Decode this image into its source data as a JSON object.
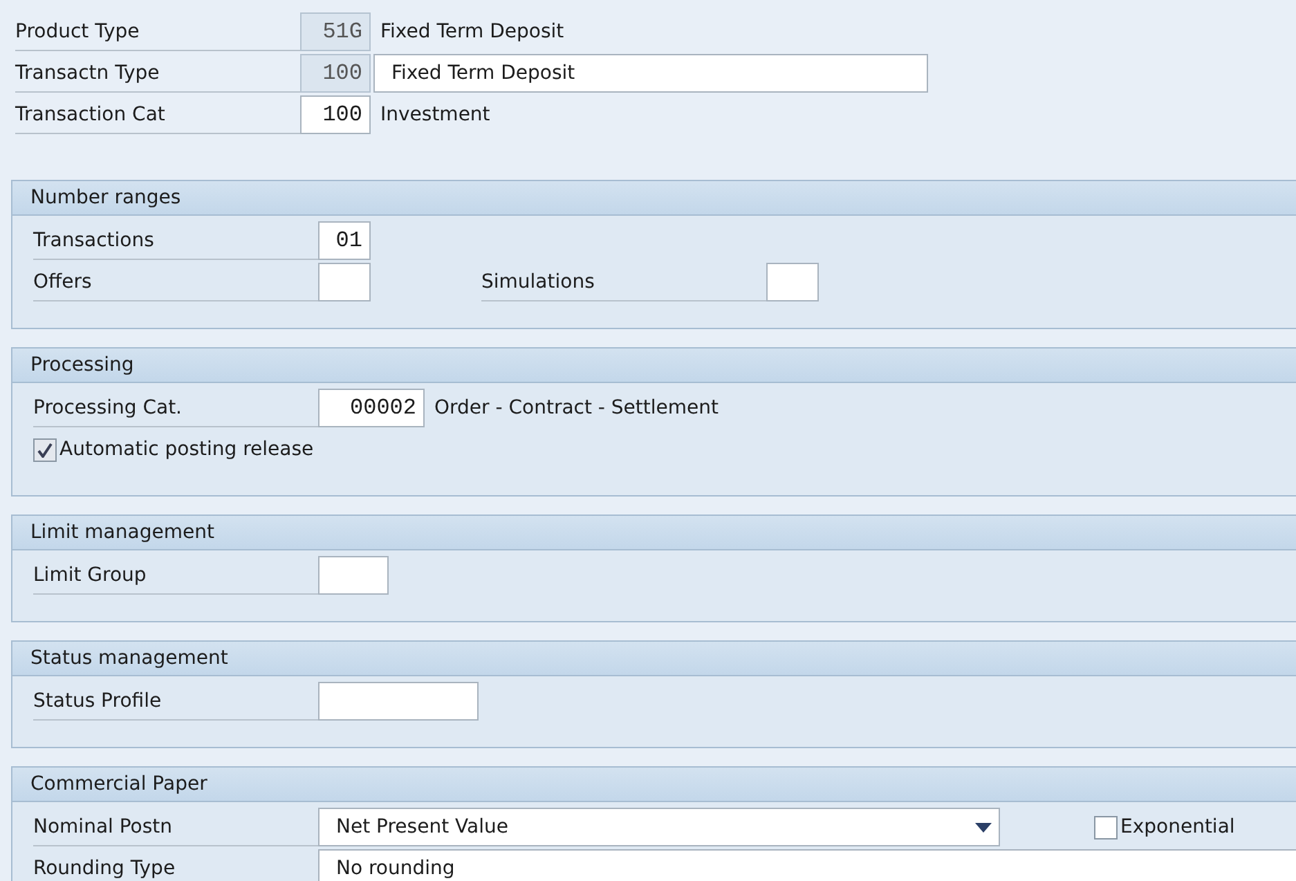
{
  "header": [
    {
      "label": "Product Type",
      "code": "51G",
      "code_readonly": true,
      "text": "Fixed Term Deposit",
      "kind": "plain"
    },
    {
      "label": "Transactn Type",
      "code": "100",
      "code_readonly": true,
      "text": "Fixed Term Deposit",
      "kind": "field"
    },
    {
      "label": "Transaction Cat",
      "code": "100",
      "code_readonly": false,
      "text": "Investment",
      "kind": "plain"
    }
  ],
  "sections": [
    {
      "title": "Number ranges",
      "rows": [
        [
          {
            "kind": "code",
            "label": "Transactions",
            "value": "01"
          }
        ],
        [
          {
            "kind": "field",
            "label": "Offers"
          },
          {
            "kind": "field",
            "label": "Simulations"
          }
        ]
      ]
    },
    {
      "title": "Processing",
      "rows": [
        [
          {
            "kind": "code",
            "label": "Processing Cat.",
            "value": "00002",
            "description": "Order - Contract - Settlement"
          }
        ],
        [
          {
            "kind": "checkbox",
            "label": "Automatic posting release",
            "checked": true
          }
        ]
      ]
    },
    {
      "title": "Limit management",
      "rows": [
        [
          {
            "kind": "field",
            "label": "Limit Group"
          }
        ]
      ]
    },
    {
      "title": "Status management",
      "rows": [
        [
          {
            "kind": "field",
            "label": "Status Profile"
          }
        ]
      ]
    },
    {
      "title": "Commercial Paper",
      "rows": [
        [
          {
            "kind": "dropdown",
            "label": "Nominal Postn",
            "value": "Net Present Value"
          },
          {
            "kind": "checkbox",
            "label": "Exponential",
            "checked": false
          }
        ],
        [
          {
            "kind": "field",
            "label": "Rounding Type",
            "value": "No rounding"
          }
        ]
      ]
    }
  ]
}
